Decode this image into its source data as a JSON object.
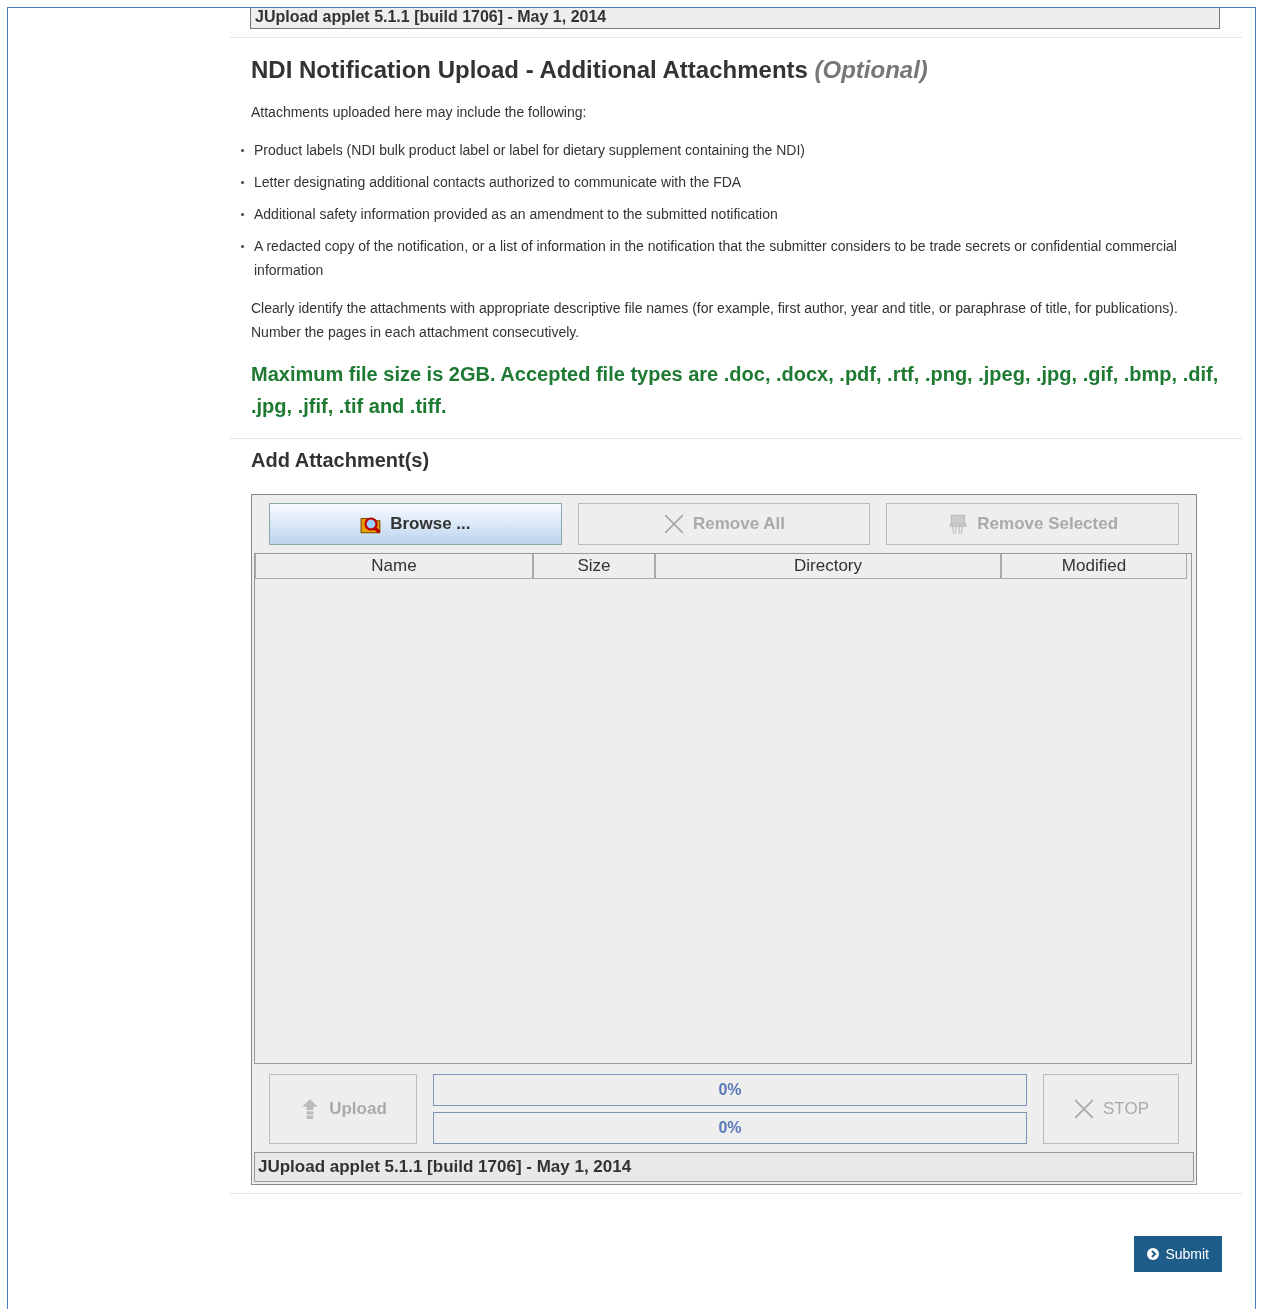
{
  "top_status": "JUpload applet 5.1.1 [build 1706] - May 1, 2014",
  "section": {
    "title": "NDI Notification Upload - Additional Attachments",
    "title_note": "(Optional)",
    "intro": "Attachments uploaded here may include the following:",
    "bullets": [
      "Product labels (NDI bulk product label or label for dietary supplement containing the NDI)",
      "Letter designating additional contacts authorized to communicate with the FDA",
      "Additional safety information provided as an amendment to the submitted notification",
      "A redacted copy of the notification, or a list of information in the notification that the submitter considers to be trade secrets or confidential commercial information"
    ],
    "instructions": "Clearly identify the attachments with appropriate descriptive file names (for example, first author, year and title, or paraphrase of title, for publications). Number the pages in each attachment consecutively.",
    "file_limits": "Maximum file size is 2GB. Accepted file types are .doc, .docx, .pdf, .rtf, .png, .jpeg, .jpg, .gif, .bmp, .dif, .jpg, .jfif, .tif and .tiff."
  },
  "attachments": {
    "title": "Add Attachment(s)",
    "toolbar": [
      {
        "label": "Browse ...",
        "kind": "browse",
        "disabled": false
      },
      {
        "label": "Remove All",
        "kind": "remove-all",
        "disabled": true
      },
      {
        "label": "Remove Selected",
        "kind": "remove-selected",
        "disabled": true
      }
    ],
    "columns": [
      "Name",
      "Size",
      "Directory",
      "Modified"
    ],
    "upload_button": {
      "label": "Upload",
      "disabled": true
    },
    "progress": [
      {
        "label": "0%",
        "level": 0
      },
      {
        "label": "0%",
        "level": 0
      }
    ],
    "stop_button": {
      "label": "STOP",
      "disabled": true
    },
    "status": "JUpload applet 5.1.1 [build 1706] - May 1, 2014"
  },
  "submit": {
    "label": "Submit"
  }
}
